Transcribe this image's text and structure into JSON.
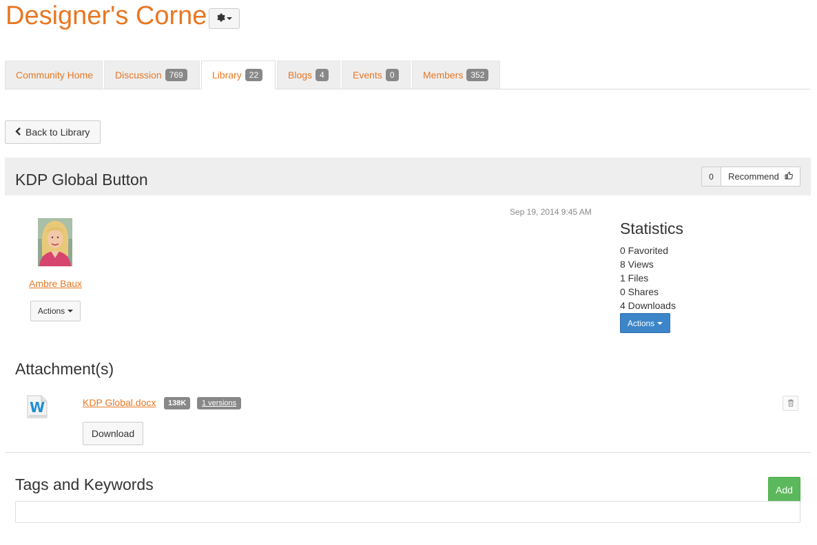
{
  "header": {
    "title": "Designer's Corner",
    "settings_icon": "gear-icon"
  },
  "tabs": [
    {
      "label": "Community Home",
      "count": null,
      "active": false
    },
    {
      "label": "Discussion",
      "count": "769",
      "active": false
    },
    {
      "label": "Library",
      "count": "22",
      "active": true
    },
    {
      "label": "Blogs",
      "count": "4",
      "active": false
    },
    {
      "label": "Events",
      "count": "0",
      "active": false
    },
    {
      "label": "Members",
      "count": "352",
      "active": false
    }
  ],
  "back_button": {
    "label": "Back to Library"
  },
  "entry": {
    "title": "KDP Global Button",
    "recommend_count": "0",
    "recommend_label": "Recommend",
    "date": "Sep 19, 2014 9:45 AM"
  },
  "author": {
    "name": "Ambre Baux",
    "actions_label": "Actions"
  },
  "statistics": {
    "title": "Statistics",
    "items": [
      "0 Favorited",
      "8 Views",
      "1 Files",
      "0 Shares",
      "4 Downloads"
    ],
    "actions_label": "Actions"
  },
  "attachments": {
    "title": "Attachment(s)",
    "file_name": "KDP Global.docx",
    "size": "138K",
    "versions": "1 versions",
    "download_label": "Download"
  },
  "tags": {
    "title": "Tags and Keywords",
    "add_label": "Add"
  },
  "colors": {
    "accent": "#e87722",
    "primary": "#3c85c9",
    "success": "#5cb85c",
    "badge": "#888888"
  }
}
